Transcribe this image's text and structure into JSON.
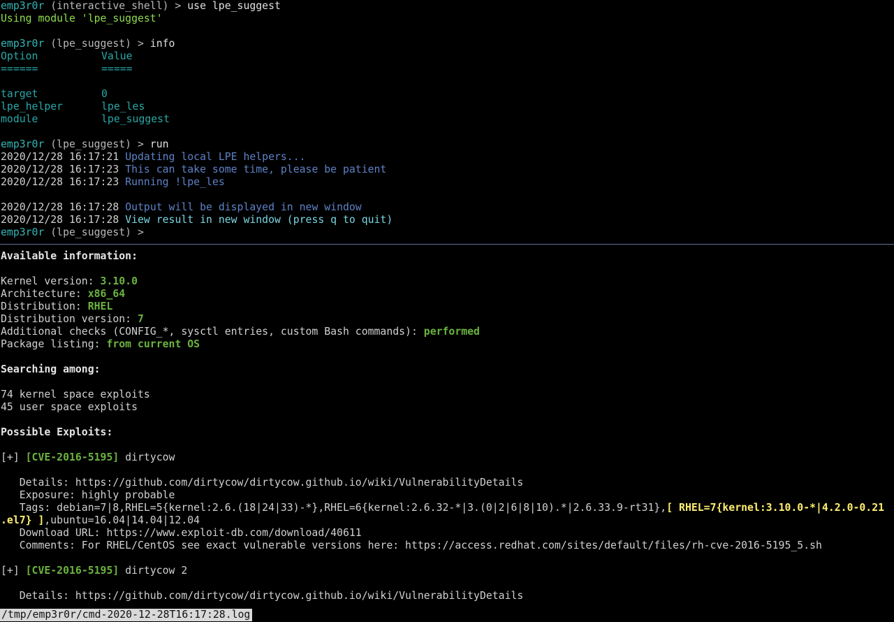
{
  "shell": {
    "user": "emp3r0r",
    "line1_ctx": " (interactive_shell) > ",
    "line1_cmd": "use lpe_suggest",
    "line2": "Using module 'lpe_suggest'",
    "line3_ctx": " (lpe_suggest) > ",
    "line3_cmd": "info",
    "info_header": [
      "Option",
      "Value"
    ],
    "info_underline": [
      "======",
      "====="
    ],
    "info_rows": [
      {
        "option": "target",
        "value": "0"
      },
      {
        "option": "lpe_helper",
        "value": "lpe_les"
      },
      {
        "option": "module",
        "value": "lpe_suggest"
      }
    ],
    "run_ctx": " (lpe_suggest) > ",
    "run_cmd": "run",
    "log": [
      {
        "time": "2020/12/28 16:17:21",
        "msg": "Updating local LPE helpers...",
        "color": "blue"
      },
      {
        "time": "2020/12/28 16:17:23",
        "msg": "This can take some time, please be patient",
        "color": "blue"
      },
      {
        "time": "2020/12/28 16:17:23",
        "msg": "Running !lpe_les",
        "color": "blue"
      },
      {
        "time": "2020/12/28 16:17:28",
        "msg": "Output will be displayed in new window",
        "color": "blue"
      },
      {
        "time": "2020/12/28 16:17:28",
        "msg": "View result in new window (press q to quit)",
        "color": "cyanlight"
      }
    ],
    "final_ctx": " (lpe_suggest) >"
  },
  "output": {
    "available_heading": "Available information:",
    "kernel_label": "Kernel version: ",
    "kernel_value": "3.10.0",
    "arch_label": "Architecture: ",
    "arch_value": "x86_64",
    "dist_label": "Distribution: ",
    "dist_value": "RHEL",
    "distver_label": "Distribution version: ",
    "distver_value": "7",
    "checks_label": "Additional checks (CONFIG_*, sysctl entries, custom Bash commands): ",
    "checks_value": "performed",
    "pkg_label": "Package listing: ",
    "pkg_value": "from current OS",
    "searching_heading": "Searching among:",
    "kernel_exploits": "74 kernel space exploits",
    "user_exploits": "45 user space exploits",
    "possible_heading": "Possible Exploits:",
    "exploits": [
      {
        "prefix": "[+] ",
        "cve": "[CVE-2016-5195]",
        "name": " dirtycow",
        "details": "   Details: https://github.com/dirtycow/dirtycow.github.io/wiki/VulnerabilityDetails",
        "exposure": "   Exposure: highly probable",
        "tags_pre": "   Tags: debian=7|8,RHEL=5{kernel:2.6.(18|24|33)-*},RHEL=6{kernel:2.6.32-*|3.(0|2|6|8|10).*|2.6.33.9-rt31},",
        "tags_highlight_1": "[ RHEL=7{kernel:3.10.0-*|4.2.0-0.21",
        "tags_highlight_2": ".el7} ]",
        "tags_post": ",ubuntu=16.04|14.04|12.04",
        "download": "   Download URL: https://www.exploit-db.com/download/40611",
        "comments": "   Comments: For RHEL/CentOS see exact vulnerable versions here: https://access.redhat.com/sites/default/files/rh-cve-2016-5195_5.sh"
      },
      {
        "prefix": "[+] ",
        "cve": "[CVE-2016-5195]",
        "name": " dirtycow 2",
        "details": "   Details: https://github.com/dirtycow/dirtycow.github.io/wiki/VulnerabilityDetails"
      }
    ]
  },
  "statusbar": {
    "path": "/tmp/emp3r0r/cmd-2020-12-28T16:17:28.log"
  },
  "colors": {
    "background": "#000000",
    "prompt_user": "#35b6b6",
    "info_cyan": "#2aa7a7",
    "log_blue": "#5e82c6",
    "highlight_green": "#6cb33f",
    "tag_yellow": "#ffee70",
    "divider": "#5d6f9a"
  }
}
